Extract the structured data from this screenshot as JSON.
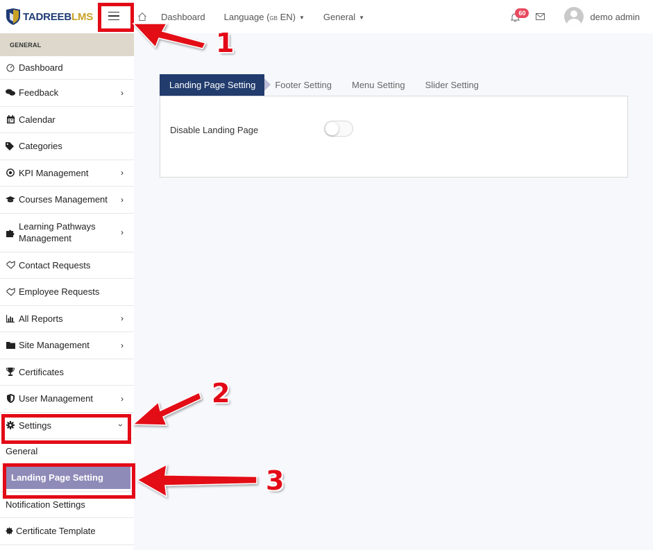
{
  "brand": {
    "part1": "TADREEB",
    "part2": "LMS"
  },
  "topnav": {
    "dashboard": "Dashboard",
    "language": "Language",
    "language_flag": "GB",
    "language_code": "EN",
    "general": "General"
  },
  "notifications": {
    "count": "60"
  },
  "user": {
    "name": "demo admin"
  },
  "sidebar": {
    "header": "GENERAL",
    "items": [
      {
        "label": "Dashboard",
        "icon": "dashboard-icon"
      },
      {
        "label": "Feedback",
        "icon": "comments-icon"
      },
      {
        "label": "Calendar",
        "icon": "calendar-icon"
      },
      {
        "label": "Categories",
        "icon": "tags-icon"
      },
      {
        "label": "KPI Management",
        "icon": "target-icon"
      },
      {
        "label": "Courses Management",
        "icon": "graduation-cap-icon"
      },
      {
        "label": "Learning Pathways Management",
        "icon": "puzzle-icon"
      },
      {
        "label": "Contact Requests",
        "icon": "handshake-icon"
      },
      {
        "label": "Employee Requests",
        "icon": "handshake-icon"
      },
      {
        "label": "All Reports",
        "icon": "bar-chart-icon"
      },
      {
        "label": "Site Management",
        "icon": "folder-icon"
      },
      {
        "label": "Certificates",
        "icon": "trophy-icon"
      },
      {
        "label": "User Management",
        "icon": "shield-icon"
      },
      {
        "label": "Settings",
        "icon": "gear-icon"
      }
    ],
    "sub_items": [
      {
        "label": "General"
      },
      {
        "label": "Landing Page Setting",
        "active": true
      },
      {
        "label": "Notification Settings"
      },
      {
        "label": "Certificate Template"
      }
    ]
  },
  "tabs": [
    {
      "label": "Landing Page Setting",
      "active": true
    },
    {
      "label": "Footer Setting"
    },
    {
      "label": "Menu Setting"
    },
    {
      "label": "Slider Setting"
    }
  ],
  "panel": {
    "toggle_label": "Disable Landing Page",
    "toggle_on": false
  },
  "annotations": [
    {
      "number": "1"
    },
    {
      "number": "2"
    },
    {
      "number": "3"
    }
  ],
  "colors": {
    "brand_navy": "#213c6d",
    "brand_gold": "#c9a227",
    "active_sidebar": "#8e8bb8",
    "sidebar_header": "#ddd8cb",
    "annotation_red": "#e30a17",
    "badge_red": "#e84a5f"
  }
}
